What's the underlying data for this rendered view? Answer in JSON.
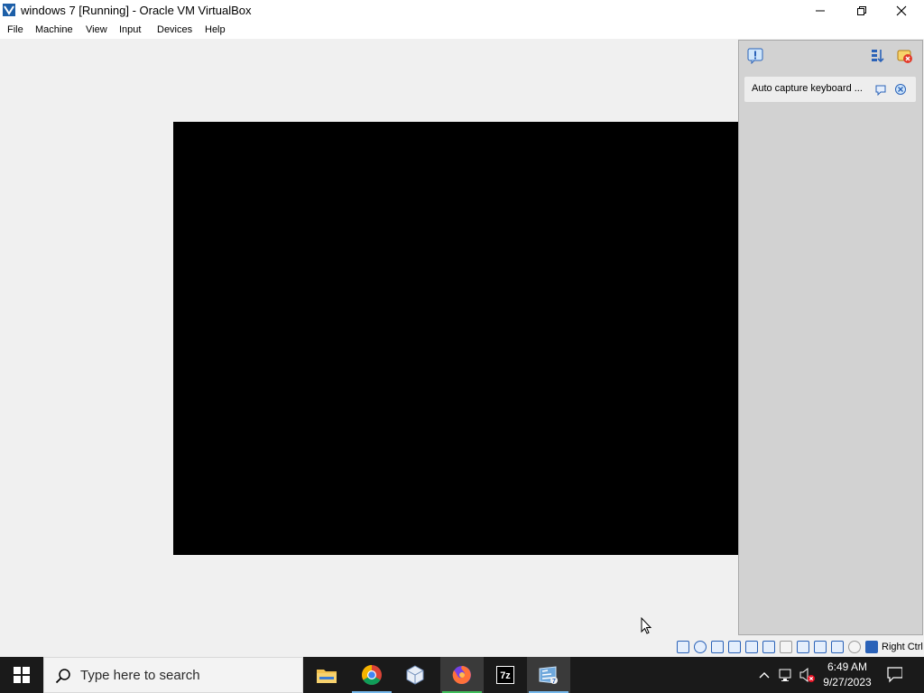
{
  "window": {
    "title": "windows 7 [Running] - Oracle VM VirtualBox",
    "icon": "virtualbox-icon",
    "controls": {
      "minimize": "minimize-icon",
      "maximize": "restore-icon",
      "close": "close-icon"
    }
  },
  "menubar": {
    "items": [
      "File",
      "Machine",
      "View",
      "Input",
      "Devices",
      "Help"
    ]
  },
  "notification_center": {
    "toolbar_icons": [
      "notification-center-icon",
      "sort-icon",
      "dismiss-all-icon"
    ],
    "messages": [
      {
        "text": "Auto capture keyboard ...",
        "actions": [
          "help-icon",
          "close-icon"
        ]
      }
    ]
  },
  "statusbar": {
    "icons": [
      "hard-disk-icon",
      "optical-drive-icon",
      "floppy-icon",
      "audio-icon",
      "network-icon",
      "usb-icon",
      "shared-folders-icon",
      "display-icon",
      "video-capture-icon",
      "virtualization-icon",
      "mouse-integration-icon",
      "keyboard-icon"
    ],
    "host_key": "Right Ctrl"
  },
  "taskbar": {
    "search_placeholder": "Type here to search",
    "apps": [
      "file-explorer-icon",
      "chrome-icon",
      "virtualbox-manager-icon",
      "firefox-icon",
      "7zip-icon",
      "virtualbox-vm-icon"
    ],
    "tray_icons": [
      "chevron-up-icon",
      "network-icon",
      "volume-muted-icon"
    ],
    "time": "6:49 AM",
    "date": "9/27/2023",
    "notification_icon": "action-center-icon"
  },
  "colors": {
    "taskbar": "#1a1a1a",
    "vm_screen": "#000000",
    "notification_panel": "#d2d2d2",
    "accent": "#76b9ed"
  }
}
